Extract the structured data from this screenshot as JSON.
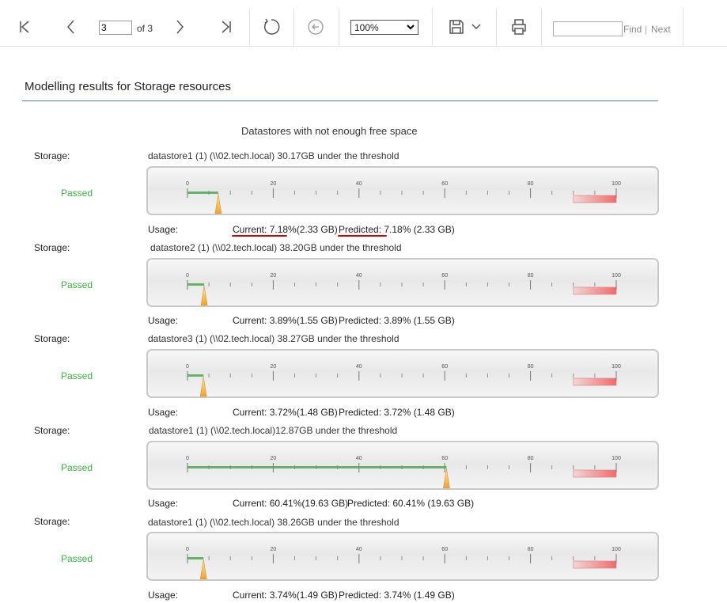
{
  "toolbar": {
    "current_page": "3",
    "page_of": "of 3",
    "zoom": "100%",
    "find_placeholder": "",
    "find_label": "Find",
    "separator": "|",
    "next_label": "Next",
    "icons": [
      "first-page-icon",
      "prev-page-icon",
      "next-page-icon",
      "last-page-icon",
      "refresh-icon",
      "back-icon",
      "save-icon",
      "print-icon"
    ]
  },
  "report": {
    "title": "Modelling results for Storage resources",
    "subtitle": "Datastores with not enough free space",
    "storage_label": "Storage:",
    "usage_label": "Usage:",
    "gauge_ticks": [
      "0",
      "20",
      "40",
      "60",
      "80",
      "100"
    ],
    "accent_color": "#3cb043",
    "highlight_color": "#d00000",
    "items": [
      {
        "name": "datastore1 (1) (\\\\02.tech.local) 30.17GB under the threshold",
        "status": "Passed",
        "percent": 7.18,
        "current_label": "Current:",
        "current_value": "7.18%(2.33 GB)",
        "predicted_label": "Predicted:",
        "predicted_value": "7.18% (2.33 GB)"
      },
      {
        "name": "datastore2 (1) (\\\\02.tech.local) 38.20GB under the threshold",
        "status": "Passed",
        "percent": 3.89,
        "current_label": "Current:",
        "current_value": "3.89%(1.55 GB)",
        "predicted_label": "Predicted:",
        "predicted_value": "3.89% (1.55 GB)"
      },
      {
        "name": "datastore3 (1) (\\\\02.tech.local) 38.27GB under the threshold",
        "status": "Passed",
        "percent": 3.72,
        "current_label": "Current:",
        "current_value": "3.72%(1.48 GB)",
        "predicted_label": "Predicted:",
        "predicted_value": "3.72% (1.48 GB)"
      },
      {
        "name": "datastore1 (1) (\\\\02.tech.local)12.87GB under the threshold",
        "status": "Passed",
        "percent": 60.41,
        "current_label": "Current:",
        "current_value": "60.41%(19.63 GB)",
        "predicted_label": "Predicted:",
        "predicted_value": "60.41% (19.63 GB)"
      },
      {
        "name": "datastore1 (1) (\\\\02.tech.local) 38.26GB under the threshold",
        "status": "Passed",
        "percent": 3.74,
        "current_label": "Current:",
        "current_value": "3.74%(1.49 GB)",
        "predicted_label": "Predicted:",
        "predicted_value": "3.74% (1.49 GB)"
      }
    ]
  }
}
